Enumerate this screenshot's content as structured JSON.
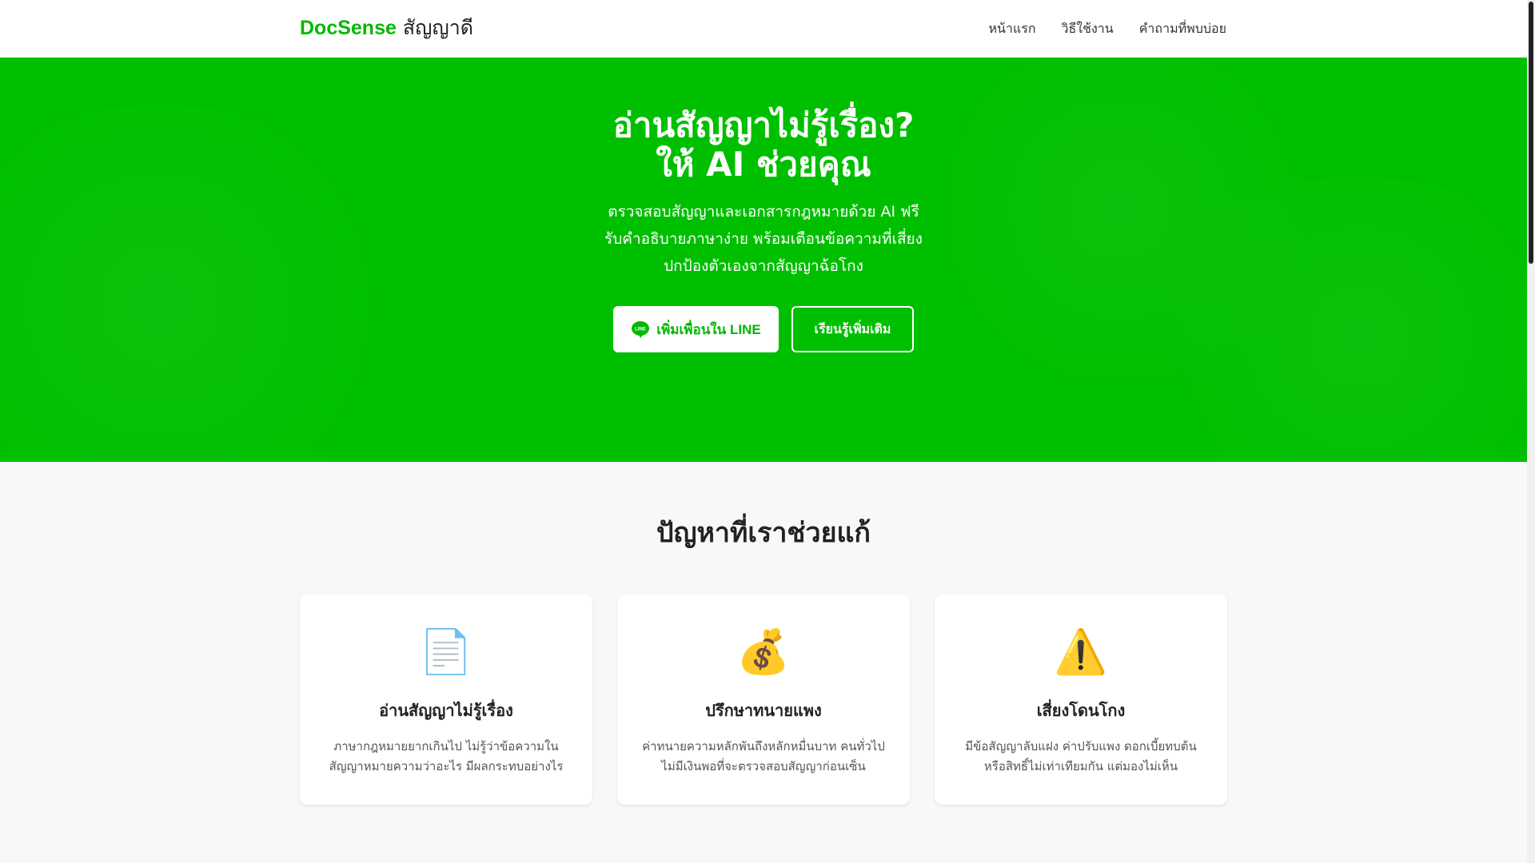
{
  "nav": {
    "logo_brand": "DocSense",
    "logo_thai": "สัญญาดี",
    "links": [
      "หน้าแรก",
      "วิธีใช้งาน",
      "คำถามที่พบบ่อย"
    ]
  },
  "hero": {
    "title_line1": "อ่านสัญญาไม่รู้เรื่อง?",
    "title_line2": "ให้ AI ช่วยคุณ",
    "subtitle": [
      "ตรวจสอบสัญญาและเอกสารกฎหมายด้วย AI ฟรี",
      "รับคำอธิบายภาษาง่าย พร้อมเตือนข้อความที่เสี่ยง",
      "ปกป้องตัวเองจากสัญญาฉ้อโกง"
    ],
    "line_button": "เพิ่มเพื่อนใน LINE",
    "line_icon_text": "LINE",
    "more_button": "เรียนรู้เพิ่มเติม"
  },
  "problems": {
    "title": "ปัญหาที่เราช่วยแก้",
    "cards": [
      {
        "icon": "📄",
        "title": "อ่านสัญญาไม่รู้เรื่อง",
        "desc1": "ภาษากฎหมายยากเกินไป ไม่รู้ว่าข้อความใน",
        "desc2": "สัญญาหมายความว่าอะไร มีผลกระทบอย่างไร"
      },
      {
        "icon": "💰",
        "title": "ปรึกษาทนายแพง",
        "desc1": "ค่าทนายความหลักพันถึงหลักหมื่นบาท คนทั่วไป",
        "desc2": "ไม่มีเงินพอที่จะตรวจสอบสัญญาก่อนเซ็น"
      },
      {
        "icon": "⚠️",
        "title": "เสี่ยงโดนโกง",
        "desc1": "มีข้อสัญญาลับแฝง ค่าปรับแพง ดอกเบี้ยทบต้น",
        "desc2": "หรือสิทธิ์ไม่เท่าเทียมกัน แต่มองไม่เห็น"
      }
    ]
  },
  "colors": {
    "brand": "#00b900",
    "hero_bg": "#00bf00",
    "page_bg": "#f7f8fa"
  }
}
